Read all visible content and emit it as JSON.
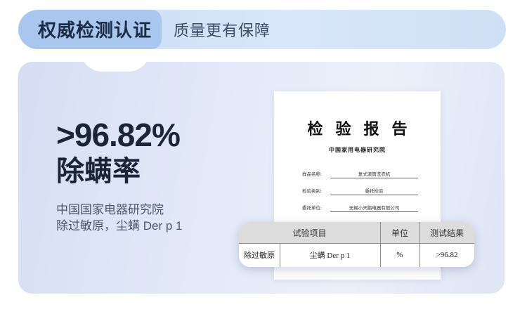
{
  "header": {
    "title": "权威检测认证",
    "subtitle": "质量更有保障"
  },
  "highlight": {
    "value": ">96.82%",
    "label": "除螨率",
    "desc_line1": "中国国家电器研究院",
    "desc_line2": "除过敏原，尘螨 Der p 1"
  },
  "report": {
    "title": "检验报告",
    "institute": "中国家用电器研究院",
    "fields": [
      {
        "key": "样品名称:",
        "value": "复式滚筒洗衣机"
      },
      {
        "key": "检验类别:",
        "value": "委托检验"
      },
      {
        "key": "委托单位:",
        "value": "无锡小天鹅电器有限公司"
      }
    ]
  },
  "table": {
    "headers": [
      "试验项目",
      "单位",
      "测试结果"
    ],
    "row": [
      "除过敏原",
      "尘螨 Der p 1",
      "%",
      ">96.82"
    ]
  }
}
